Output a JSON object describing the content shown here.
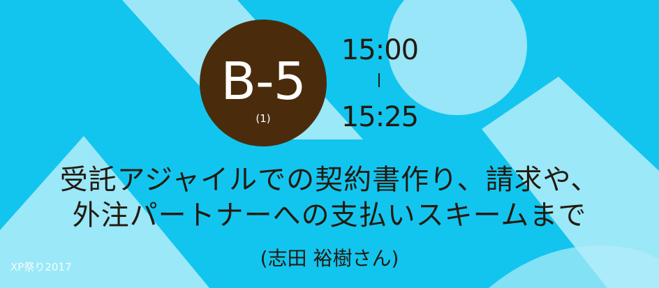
{
  "badge": {
    "code": "B-5",
    "sub": "(1)"
  },
  "time": {
    "start": "15:00",
    "end": "15:25"
  },
  "title": {
    "line1": "受託アジャイルでの契約書作り、請求や、",
    "line2": "外注パートナーへの支払いスキームまで"
  },
  "speaker": "(志田 裕樹さん)",
  "watermark": "XP祭り2017",
  "colors": {
    "background": "#12c5ef",
    "shape": "#b4edf9",
    "badge": "#4a2c0c",
    "text": "#231a10"
  }
}
